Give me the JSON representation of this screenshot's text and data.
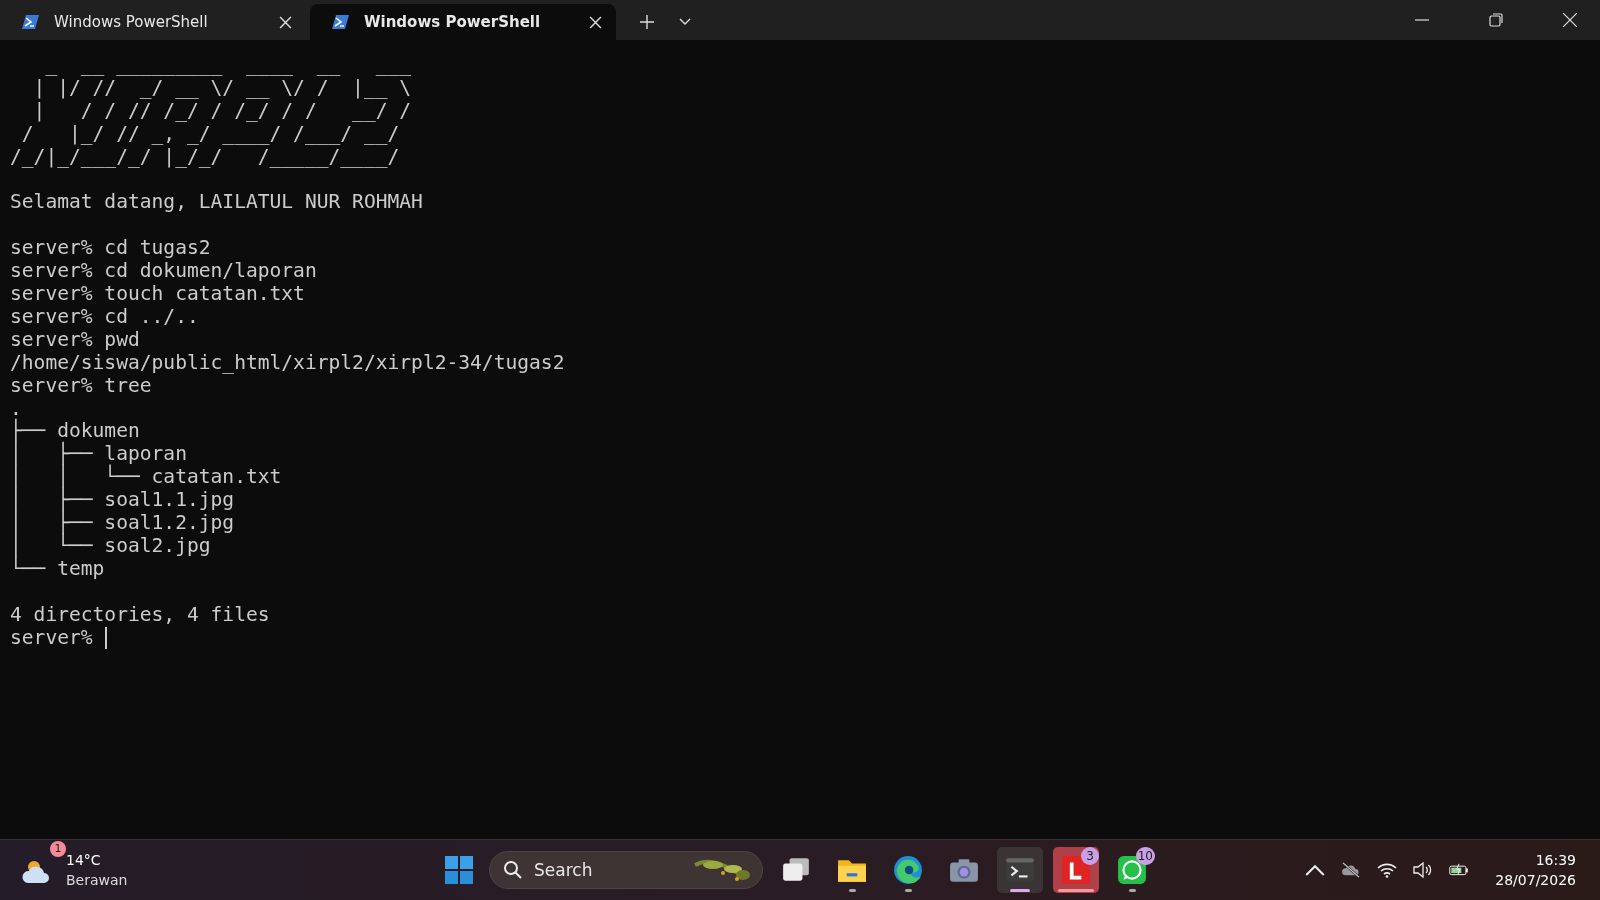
{
  "tabs": [
    {
      "title": "Windows PowerShell",
      "selected": false
    },
    {
      "title": "Windows PowerShell",
      "selected": true
    }
  ],
  "terminal": {
    "blocks": [
      [
        "   _  __ _________  ____  __   ___",
        "  | |/ //  _/ __ \\/ __ \\/ /  |__ \\",
        "  |   / / // /_/ / /_/ / /   __/ /",
        " /   |_/ // _, _/ ____/ /___/ __/",
        "/_/|_/___/_/ |_/_/   /_____/____/"
      ],
      [
        "Selamat datang, LAILATUL NUR ROHMAH"
      ],
      [
        "server% cd tugas2",
        "server% cd dokumen/laporan",
        "server% touch catatan.txt",
        "server% cd ../..",
        "server% pwd",
        "/home/siswa/public_html/xirpl2/xirpl2-34/tugas2",
        "server% tree",
        ".",
        "├── dokumen",
        "│   ├── laporan",
        "│   │   └── catatan.txt",
        "│   ├── soal1.1.jpg",
        "│   ├── soal1.2.jpg",
        "│   └── soal2.jpg",
        "└── temp"
      ],
      [
        "4 directories, 4 files"
      ]
    ],
    "prompt": "server%",
    "cursor": true
  },
  "taskbar": {
    "weather": {
      "badge": "1",
      "temperature": "14°C",
      "condition": "Berawan"
    },
    "search": {
      "placeholder": "Search"
    },
    "apps": [
      {
        "kind": "taskview",
        "running": false,
        "selected": false,
        "attention": false
      },
      {
        "kind": "files",
        "running": true,
        "selected": false,
        "attention": false
      },
      {
        "kind": "edge",
        "running": true,
        "selected": false,
        "attention": false
      },
      {
        "kind": "camera",
        "running": false,
        "selected": false,
        "attention": false
      },
      {
        "kind": "terminal",
        "running": true,
        "selected": true,
        "attention": false
      },
      {
        "kind": "letter",
        "running": true,
        "selected": false,
        "attention": true,
        "badge": "3"
      },
      {
        "kind": "whatsapp",
        "running": true,
        "selected": false,
        "attention": false,
        "badge": "10"
      }
    ],
    "clock": {
      "time": "16:39",
      "date": "28/07/2026"
    }
  }
}
